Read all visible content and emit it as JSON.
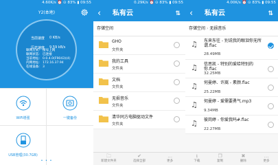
{
  "status_bars": [
    {
      "left": "",
      "right": "4.60K/s ⏰ ⊙ 83% ▮ 09:55"
    },
    {
      "left": "",
      "right": "0.29K/s ⏰ ⊙ 83% ▮ 09:55"
    },
    {
      "left": "",
      "right": "4.00K/s ⏰ ⊙ 83% ▮ 09:55"
    }
  ],
  "panel1": {
    "device_name": "Y2(本地)",
    "upload_speed_label": "当前速度",
    "upload_speed_value": "0 KB/s",
    "history_speed_label": "历史速度",
    "history_speed_value": "9.59 kB/s",
    "info": [
      {
        "key": "联网方式:",
        "value": "接号上网"
      },
      {
        "key": "联网状态:",
        "value": "已连接"
      },
      {
        "key": "当前地址:",
        "value": "0.0.4.0(F9043)(4)"
      },
      {
        "key": "内网地址:",
        "value": "172.16.37.94"
      },
      {
        "key": "在线设备:",
        "value": "3"
      }
    ],
    "tiles": [
      {
        "label": "WiFi增强",
        "icon": "wifi-icon"
      },
      {
        "label": "一键备份",
        "icon": "backup-icon"
      },
      {
        "label": "USB管理(30.7GB)",
        "icon": "usb-icon"
      }
    ],
    "page_dots": "• • •"
  },
  "panel2": {
    "title": "私有云",
    "breadcrumb": [
      "存储空间"
    ],
    "items": [
      {
        "name": "GHO",
        "sub": "文件夹"
      },
      {
        "name": "我的工具",
        "sub": "文件夹"
      },
      {
        "name": "文档",
        "sub": "文件夹"
      },
      {
        "name": "无损音乐",
        "sub": "文件夹"
      },
      {
        "name": "清华同方电脑驱动文件",
        "sub": "文件夹"
      }
    ],
    "bottom": [
      {
        "label": "新建文件夹",
        "icon": "add-folder-icon"
      },
      {
        "label": "选择全部",
        "icon": "select-all-icon"
      },
      {
        "label": "更多",
        "icon": "more-icon"
      }
    ]
  },
  "panel3": {
    "title": "私有云",
    "breadcrumb": [
      "存储空间",
      "无损音乐"
    ],
    "items": [
      {
        "name": "东来东往 - 别说我的眼泪你无所谓.flac",
        "sub": "28.49MB",
        "checked": true
      },
      {
        "name": "信思凯 - 特别的爱给特别的你.flac",
        "sub": "32.25MB",
        "checked": false
      },
      {
        "name": "何曼婷、许嵩 - 素颜.flac",
        "sub": "25.22MB",
        "checked": false
      },
      {
        "name": "何曼婷 - 爱需要勇气.mp3",
        "sub": "9.34MB",
        "checked": false
      },
      {
        "name": "彼岗婷 - 你爱我吗#.flac",
        "sub": "22.27MB",
        "checked": false
      }
    ],
    "bottom": [
      {
        "label": "下载",
        "icon": "download-icon"
      },
      {
        "label": "复制",
        "icon": "copy-icon"
      },
      {
        "label": "删除",
        "icon": "delete-icon"
      },
      {
        "label": "更多",
        "icon": "more-icon"
      }
    ]
  },
  "colors": {
    "accent": "#1f93e0",
    "folder": "#f2c24b"
  }
}
